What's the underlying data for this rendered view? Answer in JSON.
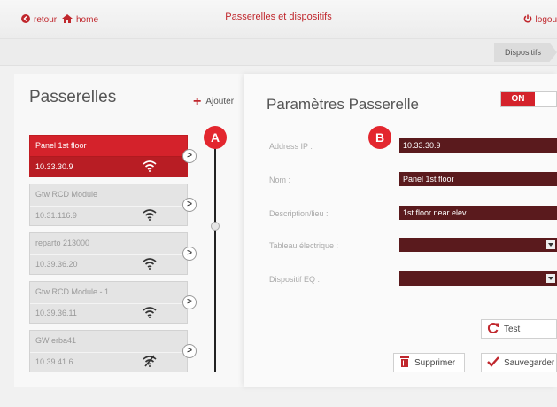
{
  "header": {
    "back_label": "retour",
    "home_label": "home",
    "title": "Passerelles et dispositifs",
    "logout_label": "logou",
    "accent_color": "#c0272d"
  },
  "breadcrumb": {
    "label": "Dispositifs"
  },
  "gateways": {
    "title": "Passerelles",
    "add_label": "Ajouter",
    "items": [
      {
        "name": "Panel 1st floor",
        "ip": "10.33.30.9",
        "active": true,
        "signal": "wifi-icon"
      },
      {
        "name": "Gtw RCD Module",
        "ip": "10.31.116.9",
        "active": false,
        "signal": "wifi-icon"
      },
      {
        "name": "reparto 213000",
        "ip": "10.39.36.20",
        "active": false,
        "signal": "wifi-icon"
      },
      {
        "name": "Gtw RCD Module - 1",
        "ip": "10.39.36.11",
        "active": false,
        "signal": "wifi-icon"
      },
      {
        "name": "GW erba41",
        "ip": "10.39.41.6",
        "active": false,
        "signal": "wifi-off-icon"
      }
    ]
  },
  "markers": {
    "a": "A",
    "b": "B"
  },
  "settings": {
    "title": "Paramètres Passerelle",
    "toggle_label": "ON",
    "fields": {
      "ip_label": "Address IP :",
      "ip_value": "10.33.30.9",
      "name_label": "Nom :",
      "name_value": "Panel 1st floor",
      "desc_label": "Description/lieu :",
      "desc_value": "1st floor near elev.",
      "board_label": "Tableau électrique :",
      "board_value": "",
      "device_label": "Dispositif EQ :",
      "device_value": ""
    },
    "test_label": "Test",
    "delete_label": "Supprimer",
    "save_label": "Sauvegarder"
  }
}
